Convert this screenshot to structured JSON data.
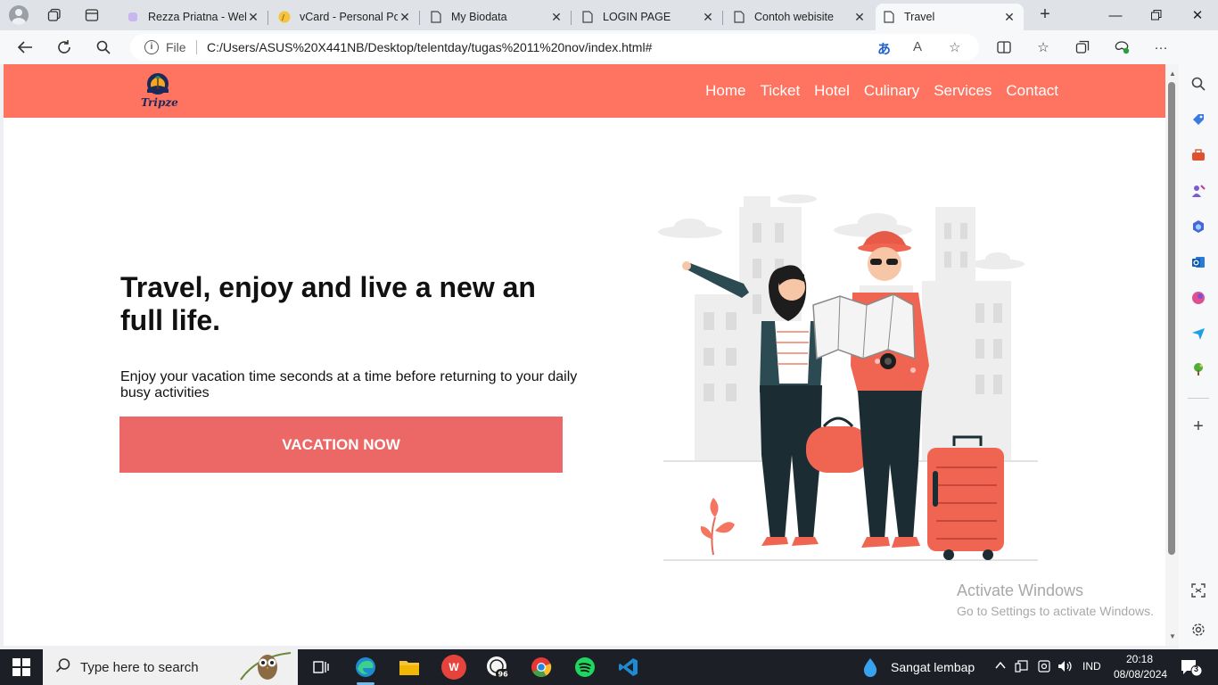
{
  "browser": {
    "tabs": [
      {
        "title": "Rezza Priatna - Web",
        "favicon": "purple-square-icon"
      },
      {
        "title": "vCard - Personal Po",
        "favicon": "vcard-icon"
      },
      {
        "title": "My Biodata",
        "favicon": "document-icon"
      },
      {
        "title": "LOGIN PAGE",
        "favicon": "document-icon"
      },
      {
        "title": "Contoh webisite",
        "favicon": "document-icon"
      },
      {
        "title": "Travel",
        "favicon": "document-icon",
        "active": true
      }
    ],
    "address": {
      "scheme_label": "File",
      "url": "C:/Users/ASUS%20X441NB/Desktop/telentday/tugas%2011%20nov/index.html#"
    }
  },
  "page": {
    "brand_color": "#ff7361",
    "button_color": "#ec6866",
    "logo_text": "Tripzee",
    "nav": [
      "Home",
      "Ticket",
      "Hotel",
      "Culinary",
      "Services",
      "Contact"
    ],
    "hero": {
      "title": "Travel, enjoy and live a new an full life.",
      "subtitle": "Enjoy your vacation time seconds at a time before returning to your daily busy activities",
      "cta": "VACATION NOW"
    }
  },
  "watermark": {
    "line1": "Activate Windows",
    "line2": "Go to Settings to activate Windows."
  },
  "taskbar": {
    "search_placeholder": "Type here to search",
    "weather": "Sangat lembap",
    "language": "IND",
    "time": "20:18",
    "date": "08/08/2024",
    "notification_count": "3",
    "whatsapp_badge": "96"
  }
}
